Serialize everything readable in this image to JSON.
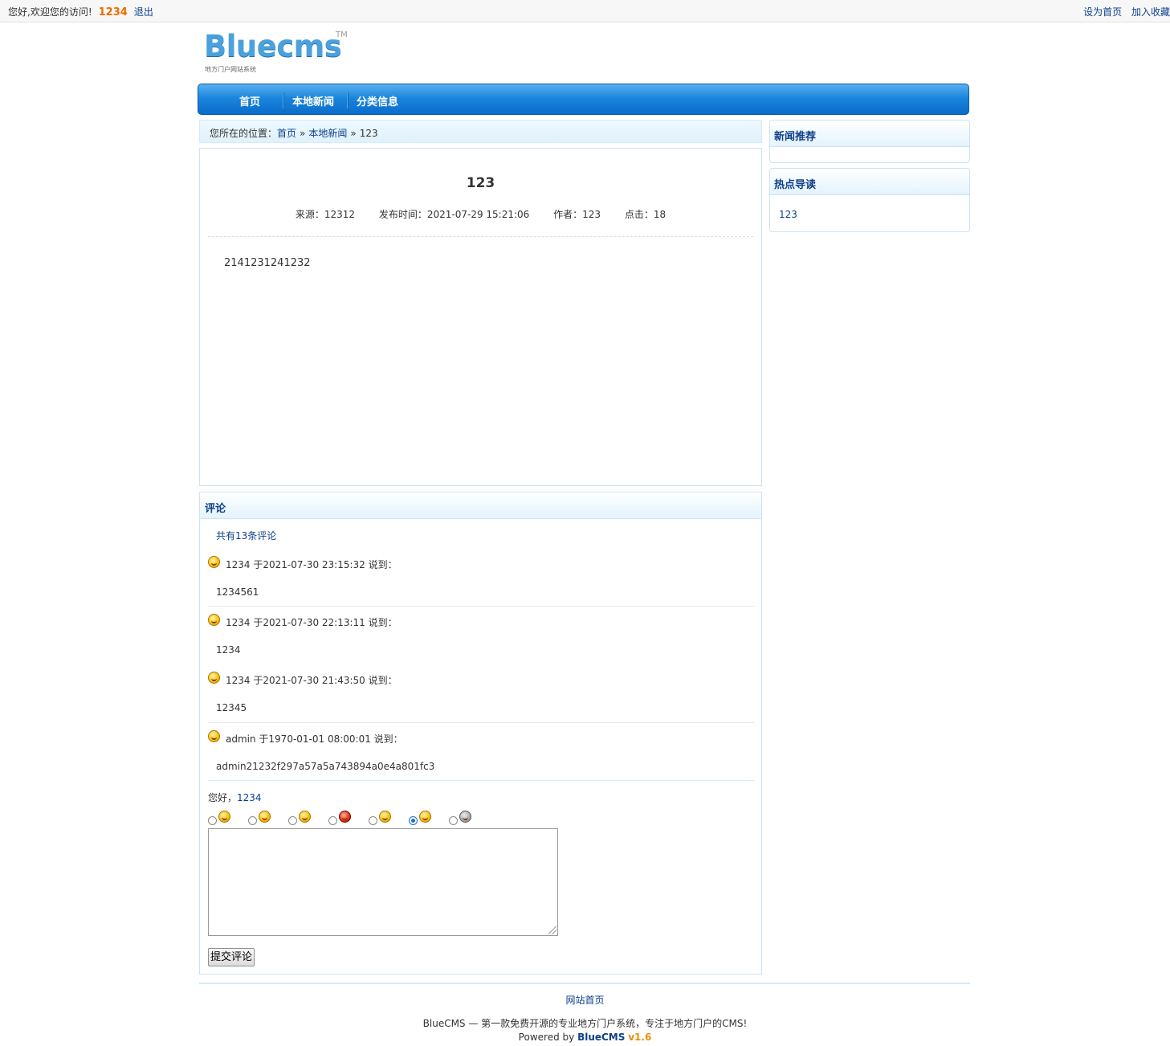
{
  "topbar": {
    "greeting": "您好,欢迎您的访问!",
    "username": "1234",
    "logout": "退出",
    "set_home": "设为首页",
    "add_fav": "加入收藏"
  },
  "logo": {
    "word": "Bluecms",
    "tm": "TM",
    "subtitle": "地方门户网站系统"
  },
  "nav": {
    "items": [
      "首页",
      "本地新闻",
      "分类信息"
    ]
  },
  "breadcrumb": {
    "label": "您所在的位置：",
    "home": "首页",
    "section": "本地新闻",
    "current": "123",
    "separator": "»"
  },
  "article": {
    "title": "123",
    "source": "来源：12312",
    "time": "发布时间：2021-07-29 15:21:06",
    "author": "作者：123",
    "clicks": "点击：18",
    "body": "2141231241232"
  },
  "comments": {
    "title": "评论",
    "count": "共有13条评论",
    "items": [
      {
        "head": "1234 于2021-07-30 23:15:32 说到：",
        "text": "1234561"
      },
      {
        "head": "1234 于2021-07-30 22:13:11 说到：",
        "text": "1234"
      },
      {
        "head": "1234 于2021-07-30 21:43:50 说到：",
        "text": "12345"
      },
      {
        "head": "admin 于1970-01-01 08:00:01 说到：",
        "text": "admin21232f297a57a5a743894a0e4a801fc3"
      }
    ],
    "hello": "您好，",
    "hello_user": "1234",
    "selected_face": 6,
    "textarea": "",
    "submit": "提交评论"
  },
  "sidebar": {
    "news_title": "新闻推荐",
    "hot_title": "热点导读",
    "hot_items": [
      "123"
    ]
  },
  "footer": {
    "link": "网站首页",
    "desc": "BlueCMS — 第一款免费开源的专业地方门户系统，专注于地方门户的CMS!",
    "powered": "Powered by",
    "brand": "BlueCMS",
    "version": "v1.6"
  },
  "colors": {
    "accent": "#0d3f8a",
    "nav": "#1b86dd",
    "username": "#f06a00"
  }
}
